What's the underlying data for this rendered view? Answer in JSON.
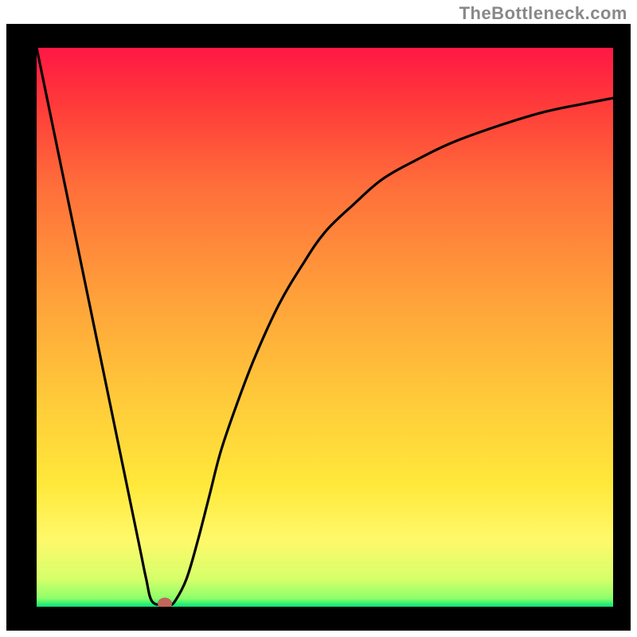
{
  "attribution": "TheBottleneck.com",
  "chart_data": {
    "type": "line",
    "title": "",
    "xlabel": "",
    "ylabel": "",
    "xlim": [
      0,
      100
    ],
    "ylim": [
      0,
      100
    ],
    "grid": false,
    "legend": false,
    "background_gradient": {
      "direction": "bottom",
      "stops": [
        {
          "pos": 0.0,
          "color": "#ff1744"
        },
        {
          "pos": 0.1,
          "color": "#ff3a3a"
        },
        {
          "pos": 0.25,
          "color": "#ff6f3a"
        },
        {
          "pos": 0.45,
          "color": "#ffa23a"
        },
        {
          "pos": 0.62,
          "color": "#ffc83a"
        },
        {
          "pos": 0.78,
          "color": "#ffe83a"
        },
        {
          "pos": 0.88,
          "color": "#fff96a"
        },
        {
          "pos": 0.95,
          "color": "#d6ff6a"
        },
        {
          "pos": 0.985,
          "color": "#8eff6a"
        },
        {
          "pos": 1.0,
          "color": "#00e676"
        }
      ]
    },
    "series": [
      {
        "name": "bottleneck-curve",
        "color": "#000000",
        "x": [
          0,
          2,
          4,
          6,
          8,
          10,
          12,
          14,
          16,
          18,
          19,
          20,
          22,
          23,
          24,
          26,
          28,
          30,
          32,
          35,
          38,
          42,
          46,
          50,
          55,
          60,
          66,
          72,
          80,
          88,
          95,
          100
        ],
        "y": [
          100,
          90,
          80,
          70,
          60,
          50,
          40,
          30,
          20,
          10,
          5,
          1,
          0.3,
          0.3,
          1,
          5,
          12,
          20,
          28,
          37,
          45,
          54,
          61,
          67,
          72,
          76.5,
          80,
          83,
          86,
          88.5,
          90,
          91
        ]
      }
    ],
    "marker": {
      "x": 22.2,
      "y": 0.6,
      "color": "#c2655a"
    }
  }
}
